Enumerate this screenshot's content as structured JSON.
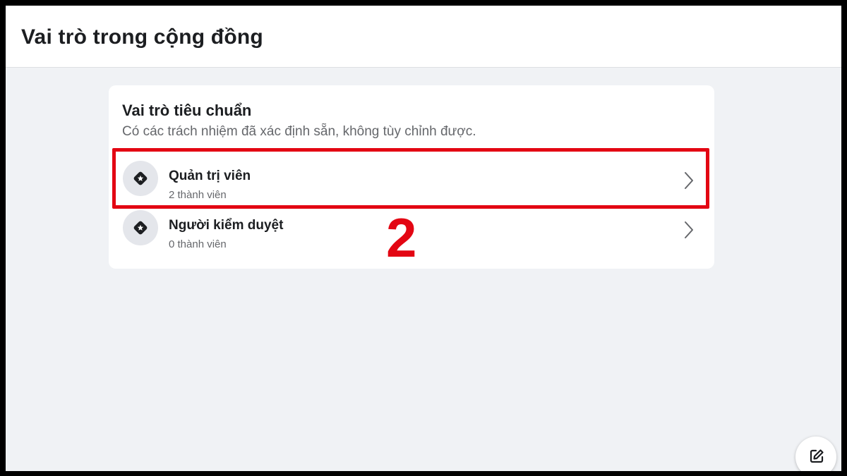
{
  "header": {
    "title": "Vai trò trong cộng đồng"
  },
  "card": {
    "title": "Vai trò tiêu chuẩn",
    "subtitle": "Có các trách nhiệm đã xác định sẵn, không tùy chỉnh được.",
    "roles": [
      {
        "name": "Quản trị viên",
        "count": "2 thành viên",
        "icon": "admin-star-diamond-icon"
      },
      {
        "name": "Người kiểm duyệt",
        "count": "0 thành viên",
        "icon": "moderator-star-diamond-icon"
      }
    ]
  },
  "annotation": {
    "step_number": "2",
    "highlight_color": "#e30613"
  },
  "floating": {
    "compose_icon": "compose-icon"
  },
  "colors": {
    "page_background": "#f0f2f5",
    "card_background": "#ffffff",
    "primary_text": "#1c1e21",
    "secondary_text": "#65676b",
    "icon_background": "#e4e6eb"
  }
}
